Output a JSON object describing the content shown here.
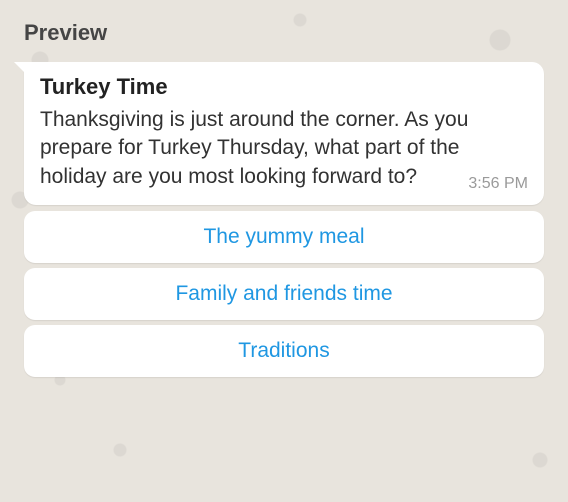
{
  "header": {
    "preview_label": "Preview"
  },
  "message": {
    "title": "Turkey Time",
    "body": "Thanksgiving is just around the corner. As you prepare for Turkey Thursday, what part of the holiday are you most looking forward to?",
    "time": "3:56 PM"
  },
  "options": [
    {
      "label": "The yummy meal"
    },
    {
      "label": "Family and friends time"
    },
    {
      "label": "Traditions"
    }
  ]
}
